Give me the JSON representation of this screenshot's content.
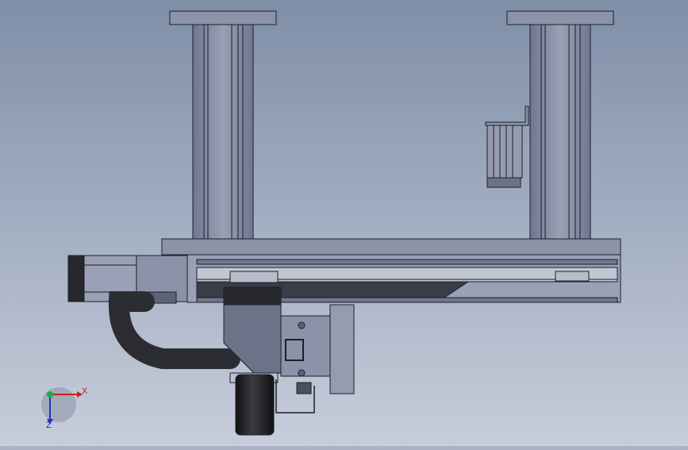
{
  "viewport": {
    "background_top": "#7f8fa8",
    "background_bottom": "#c7cddb"
  },
  "triad": {
    "x_label": "X",
    "y_label": "Z",
    "x_color": "#c81e1e",
    "y_color": "#1e32c8",
    "origin_color": "#1faa3a"
  },
  "colors": {
    "frame_metal": "#8b93a8",
    "frame_dark": "#5c6377",
    "outline": "#1c1f27",
    "cable": "#2b2d33",
    "wheel": "#24262b"
  }
}
